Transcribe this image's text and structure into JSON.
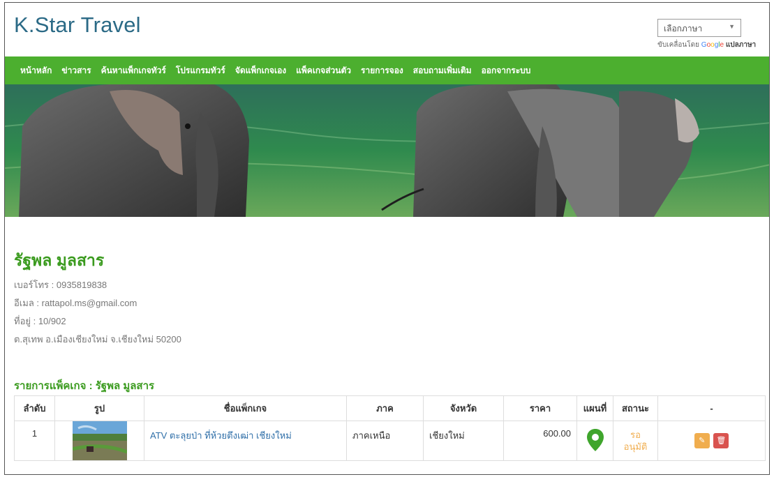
{
  "site": {
    "brand": "K.Star Travel",
    "language_select": {
      "value": "เลือกภาษา"
    },
    "powered_by": "ขับเคลื่อนโดย",
    "google": [
      "G",
      "o",
      "o",
      "g",
      "l",
      "e"
    ],
    "translate": "แปลภาษา"
  },
  "nav": {
    "items": [
      "หน้าหลัก",
      "ข่าวสาร",
      "ค้นหาแพ็กเกจทัวร์",
      "โปรแกรมทัวร์",
      "จัดแพ็กเกจเอง",
      "แพ็คเกจส่วนตัว",
      "รายการจอง",
      "สอบถามเพิ่มเติม",
      "ออกจากระบบ"
    ]
  },
  "profile": {
    "name": "รัฐพล มูลสาร",
    "phone": "เบอร์โทร : 0935819838",
    "email": "อีเมล : rattapol.ms@gmail.com",
    "address_line1": "ที่อยู่ : 10/902",
    "address_line2": "ต.สุเทพ อ.เมืองเชียงใหม่ จ.เชียงใหม่ 50200"
  },
  "packages": {
    "title": "รายการแพ็คเกจ : รัฐพล มูลสาร",
    "columns": [
      "ลำดับ",
      "รูป",
      "ชื่อแพ็กเกจ",
      "ภาค",
      "จังหวัด",
      "ราคา",
      "แผนที่",
      "สถานะ",
      "-"
    ],
    "rows": [
      {
        "no": "1",
        "name": "ATV ตะลุยป่า ที่ห้วยตึงเฒ่า เชียงใหม่",
        "region": "ภาคเหนือ",
        "province": "เชียงใหม่",
        "price": "600.00",
        "status_line1": "รอ",
        "status_line2": "อนุมัติ"
      }
    ]
  },
  "colors": {
    "nav_green": "#4caf2f",
    "title_green": "#3b9b1f",
    "brand_blue": "#2b6a86",
    "status_orange": "#f0ad4e",
    "delete_red": "#d9534f"
  }
}
